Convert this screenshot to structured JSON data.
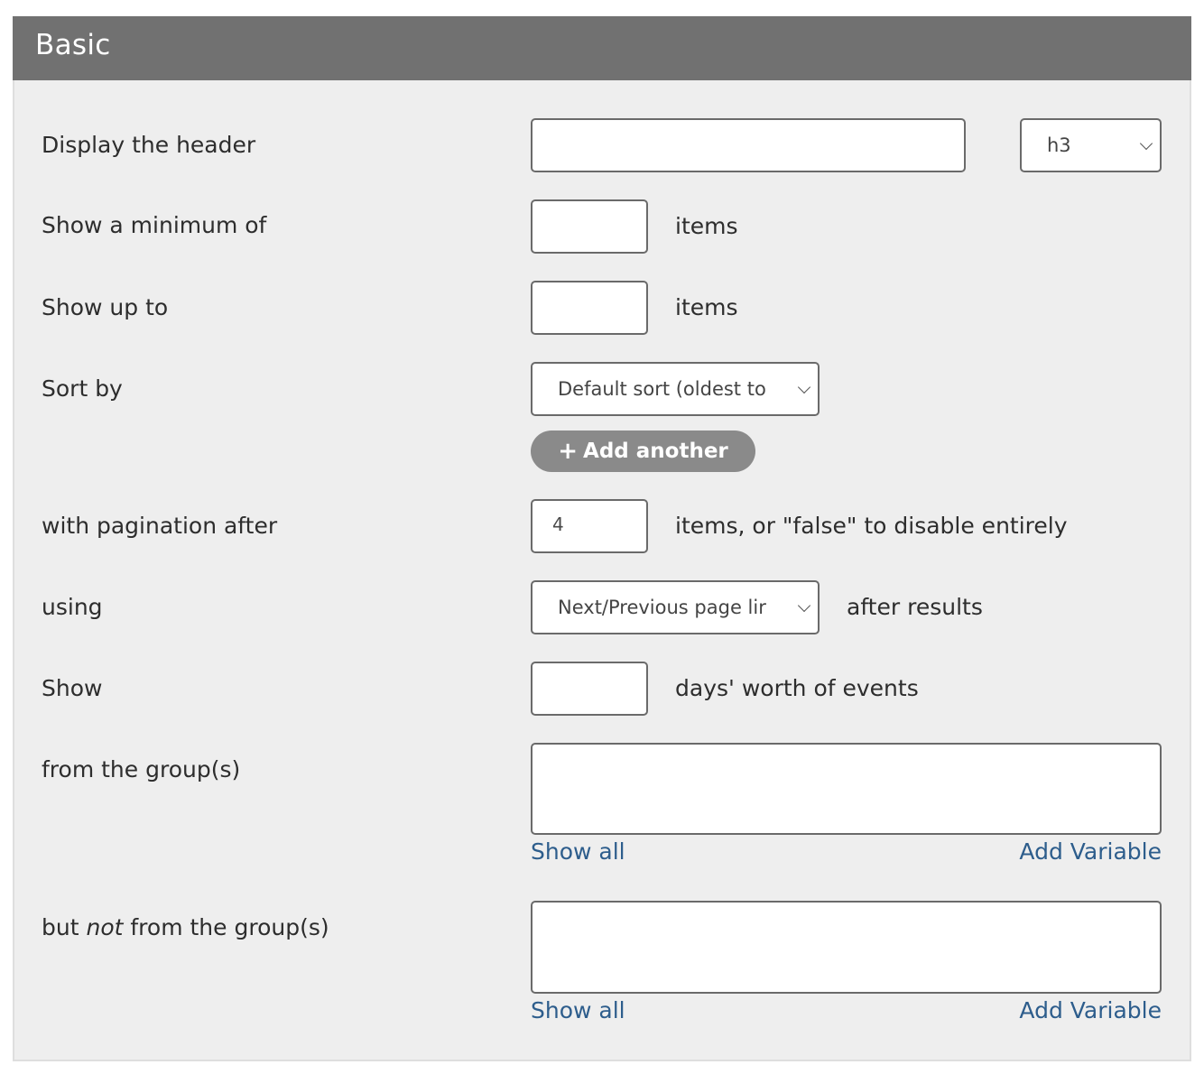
{
  "panel": {
    "title": "Basic"
  },
  "fields": {
    "header": {
      "label": "Display the header",
      "value": "",
      "level_select": "h3"
    },
    "min_items": {
      "label": "Show a minimum of",
      "value": "",
      "suffix": "items"
    },
    "max_items": {
      "label": "Show up to",
      "value": "",
      "suffix": "items"
    },
    "sort": {
      "label": "Sort by",
      "selected": "Default sort (oldest to",
      "add_button": "Add another",
      "add_icon": "plus-icon"
    },
    "pagination": {
      "label": "with pagination after",
      "value": "4",
      "suffix": "items, or \"false\" to disable entirely"
    },
    "using": {
      "label": "using",
      "selected": "Next/Previous page lir",
      "suffix": "after results"
    },
    "days": {
      "label": "Show",
      "value": "",
      "suffix": "days' worth of events"
    },
    "groups": {
      "label": "from the group(s)",
      "value": "",
      "show_all": "Show all",
      "add_variable": "Add Variable"
    },
    "not_groups": {
      "label_pre": "but ",
      "label_em": "not",
      "label_post": " from the group(s)",
      "value": "",
      "show_all": "Show all",
      "add_variable": "Add Variable"
    }
  }
}
